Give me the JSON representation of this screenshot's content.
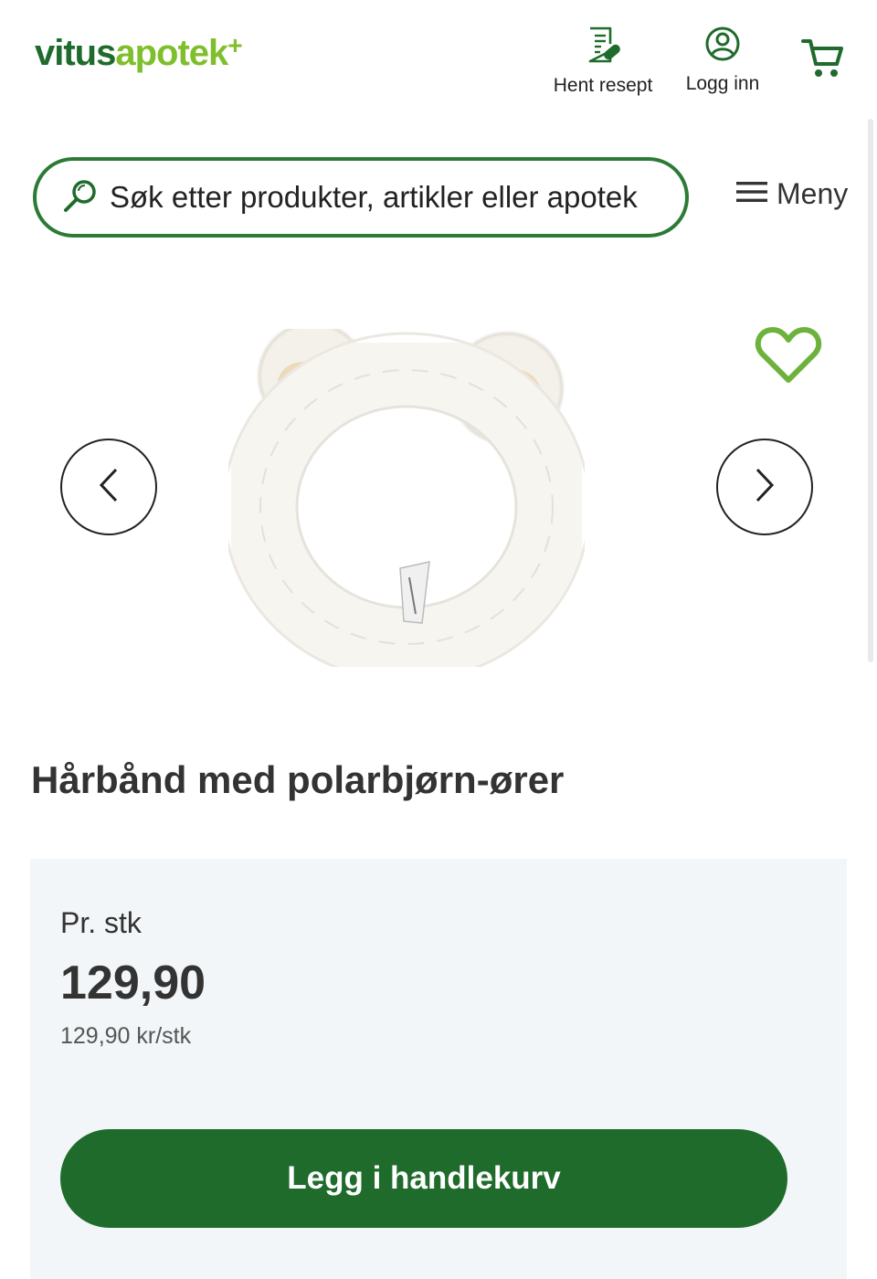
{
  "header": {
    "logo": {
      "part1": "vitus",
      "part2": "apotek",
      "plus": "+"
    },
    "prescription_label": "Hent resept",
    "login_label": "Logg inn",
    "icons": {
      "prescription": "prescription-icon",
      "account": "user-circle-icon",
      "cart": "cart-icon"
    }
  },
  "search": {
    "placeholder": "Søk etter produkter, artikler eller apotek",
    "icon": "search-icon"
  },
  "menu": {
    "label": "Meny",
    "icon": "hamburger-icon"
  },
  "gallery": {
    "favorite_icon": "heart-icon",
    "prev_icon": "chevron-left-icon",
    "next_icon": "chevron-right-icon"
  },
  "product": {
    "title": "Hårbånd med polarbjørn-ører",
    "unit_label": "Pr. stk",
    "price": "129,90",
    "price_per_unit": "129,90 kr/stk",
    "add_to_cart_label": "Legg i handlekurv"
  },
  "colors": {
    "brand_dark_green": "#1f6b2c",
    "brand_light_green": "#7fbf2c",
    "search_border": "#2d7a37",
    "price_box_bg": "#f2f6f8"
  }
}
